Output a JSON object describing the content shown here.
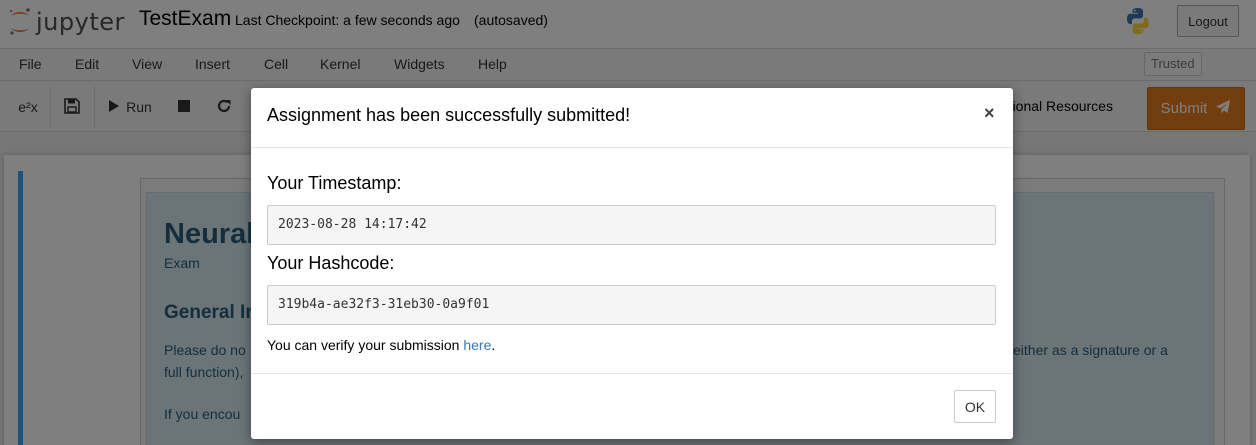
{
  "header": {
    "logo_text": "jupyter",
    "notebook_name": "TestExam",
    "checkpoint": "Last Checkpoint: a few seconds ago",
    "autosave_status": "(autosaved)",
    "logout_label": "Logout"
  },
  "menubar": {
    "items": [
      "File",
      "Edit",
      "View",
      "Insert",
      "Cell",
      "Kernel",
      "Widgets",
      "Help"
    ],
    "trusted_label": "Trusted"
  },
  "toolbar": {
    "e2x_label": "e²x",
    "run_label": "Run",
    "additional_resources_label": "dditional Resources",
    "submit_label": "Submit",
    "submit_color": "#e57c1f"
  },
  "notebook": {
    "title": "Neural",
    "subtitle": "Exam",
    "heading": "General In",
    "para1_left": "Please do no",
    "para1_right": "either as a signature or a",
    "para1_line2": "full function),",
    "para2": "If you encou",
    "cell_accent_color": "#42a5f5"
  },
  "modal": {
    "title": "Assignment has been successfully submitted!",
    "close_symbol": "×",
    "timestamp_label": "Your Timestamp:",
    "timestamp_value": "2023-08-28 14:17:42",
    "hashcode_label": "Your Hashcode:",
    "hashcode_value": "319b4a-ae32f3-31eb30-0a9f01",
    "verify_prefix": "You can verify your submission ",
    "verify_link": "here",
    "verify_suffix": ".",
    "ok_label": "OK"
  }
}
